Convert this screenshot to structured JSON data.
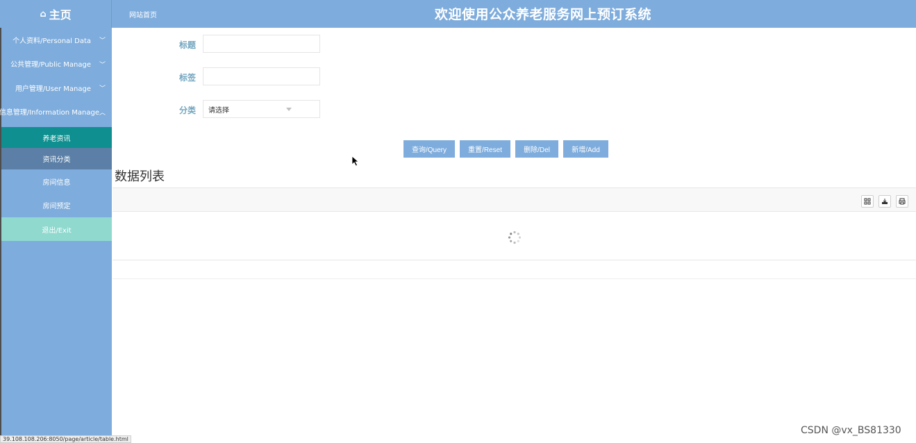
{
  "header": {
    "home_icon": "home-icon",
    "home_label": "主页",
    "site_link": "网站首页",
    "title": "欢迎使用公众养老服务网上预订系统"
  },
  "sidebar": {
    "items": [
      {
        "label": "个人资料/Personal Data",
        "icon": "chevron-down-icon"
      },
      {
        "label": "公共管理/Public Manage",
        "icon": "chevron-down-icon"
      },
      {
        "label": "用户管理/User Manage",
        "icon": "chevron-down-icon"
      },
      {
        "label": "信息管理/Information Manage",
        "icon": "chevron-up-icon"
      }
    ],
    "subitems": [
      {
        "label": "养老资讯"
      },
      {
        "label": "资讯分类"
      },
      {
        "label": "房间信息"
      },
      {
        "label": "房间预定"
      }
    ],
    "logout_label": "退出/Exit"
  },
  "form": {
    "title_label": "标题",
    "title_value": "",
    "tag_label": "标签",
    "tag_value": "",
    "category_label": "分类",
    "category_placeholder": "请选择"
  },
  "buttons": {
    "query": "查询/Query",
    "reset": "重置/Reset",
    "delete": "删除/Del",
    "add": "新增/Add"
  },
  "list": {
    "title": "数据列表",
    "tools": [
      "columns-icon",
      "export-icon",
      "print-icon"
    ],
    "loading": true
  },
  "watermark": "CSDN @vx_BS81330",
  "status_url": "39.108.108.206:8050/page/article/table.html"
}
